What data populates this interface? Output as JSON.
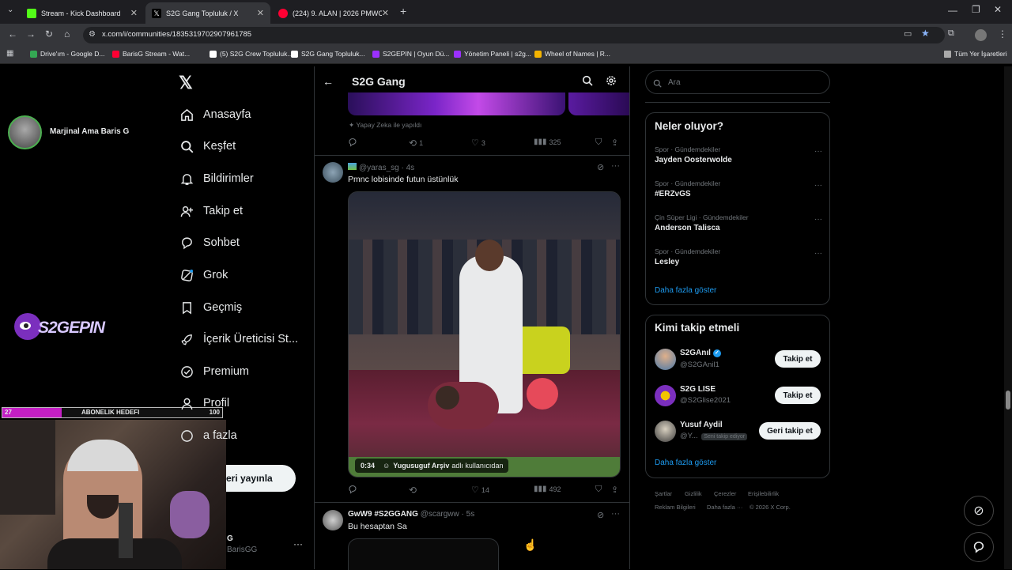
{
  "browser": {
    "tabs": [
      {
        "title": "Stream - Kick Dashboard",
        "color": "#53fc18"
      },
      {
        "title": "S2G Gang Topluluk / X",
        "color": "#ffffff"
      },
      {
        "title": "(224) 9. ALAN | 2026 PMWC Ş...",
        "color": "#ff0033"
      }
    ],
    "url": "x.com/i/communities/1835319702907961785",
    "bookmarks": [
      {
        "label": "Drive'ım - Google D...",
        "color": "#34a853"
      },
      {
        "label": "BarisG Stream - Wat...",
        "color": "#ff0033"
      },
      {
        "label": "(5) S2G Crew Topluluk...",
        "color": "#ffffff"
      },
      {
        "label": "S2G Gang Topluluk...",
        "color": "#ffffff"
      },
      {
        "label": "S2GEPIN | Oyun Dü...",
        "color": "#9b30ff"
      },
      {
        "label": "Yönetim Paneli | s2g...",
        "color": "#9b30ff"
      },
      {
        "label": "Wheel of Names | R...",
        "color": "#f4b400"
      }
    ],
    "all_bookmarks": "Tüm Yer İşaretleri"
  },
  "stream_overlay": {
    "streamer_name": "Marjinal Ama Baris G",
    "brand": "S2GEPIN",
    "goal": {
      "current": "27",
      "label": "ABONELIK HEDEFI",
      "target": "100",
      "progress": 0.27,
      "color": "#c41fc4"
    }
  },
  "sidebar": {
    "items": [
      {
        "label": "Anasayfa",
        "icon": "home-icon"
      },
      {
        "label": "Keşfet",
        "icon": "search-icon"
      },
      {
        "label": "Bildirimler",
        "icon": "bell-icon"
      },
      {
        "label": "Takip et",
        "icon": "follow-icon"
      },
      {
        "label": "Sohbet",
        "icon": "chat-icon"
      },
      {
        "label": "Grok",
        "icon": "grok-icon"
      },
      {
        "label": "Geçmiş",
        "icon": "bookmark-icon"
      },
      {
        "label": "İçerik Üreticisi St...",
        "icon": "rocket-icon"
      },
      {
        "label": "Premium",
        "icon": "verified-icon"
      },
      {
        "label": "Profil",
        "icon": "profile-icon"
      },
      {
        "label": "a fazla",
        "icon": "more-icon"
      }
    ],
    "post_button": "eri yayınla",
    "account_name": "G",
    "account_handle": "BarisGG"
  },
  "header": {
    "title": "S2G Gang"
  },
  "posts": [
    {
      "ai_label": "Yapay Zeka ile yapıldı",
      "replies": "",
      "reposts": "1",
      "likes": "3",
      "views": "325"
    },
    {
      "handle": "@yaras_sg",
      "time": "4s",
      "text": "Pmnc lobisinde futun üstünlük",
      "video_duration": "0:34",
      "video_source": "Yugusuguf Arşiv",
      "video_source_suffix": "adlı kullanıcıdan",
      "reposts": "",
      "likes": "14",
      "views": "492"
    },
    {
      "name": "GwW9 #S2GGANG",
      "handle": "@scargww",
      "time": "5s",
      "text": "Bu hesaptan Sa"
    }
  ],
  "search": {
    "placeholder": "Ara"
  },
  "trends": {
    "title": "Neler oluyor?",
    "items": [
      {
        "category": "Spor · Gündemdekiler",
        "name": "Jayden Oosterwolde"
      },
      {
        "category": "Spor · Gündemdekiler",
        "name": "#ERZvGS"
      },
      {
        "category": "Çin Süper Ligi · Gündemdekiler",
        "name": "Anderson Talisca"
      },
      {
        "category": "Spor · Gündemdekiler",
        "name": "Lesley"
      }
    ],
    "show_more": "Daha fazla göster"
  },
  "who_to_follow": {
    "title": "Kimi takip etmeli",
    "users": [
      {
        "name": "S2GAnıl",
        "handle": "@S2GAnil1",
        "button": "Takip et",
        "badge": ""
      },
      {
        "name": "S2G LISE",
        "handle": "@S2Glise2021",
        "button": "Takip et",
        "badge": ""
      },
      {
        "name": "Yusuf Aydil",
        "handle": "@Y...",
        "button": "Geri takip et",
        "badge": "Seni takip ediyor"
      }
    ],
    "show_more": "Daha fazla göster"
  },
  "footer": {
    "links": [
      "Şartlar",
      "Gizlilik",
      "Çerezler",
      "Erişilebilirlik",
      "Reklam Bilgileri",
      "Daha fazla ···",
      "© 2026 X Corp."
    ]
  },
  "colors": {
    "accent": "#1d9bf0",
    "border": "#2f3336",
    "muted": "#71767b"
  }
}
